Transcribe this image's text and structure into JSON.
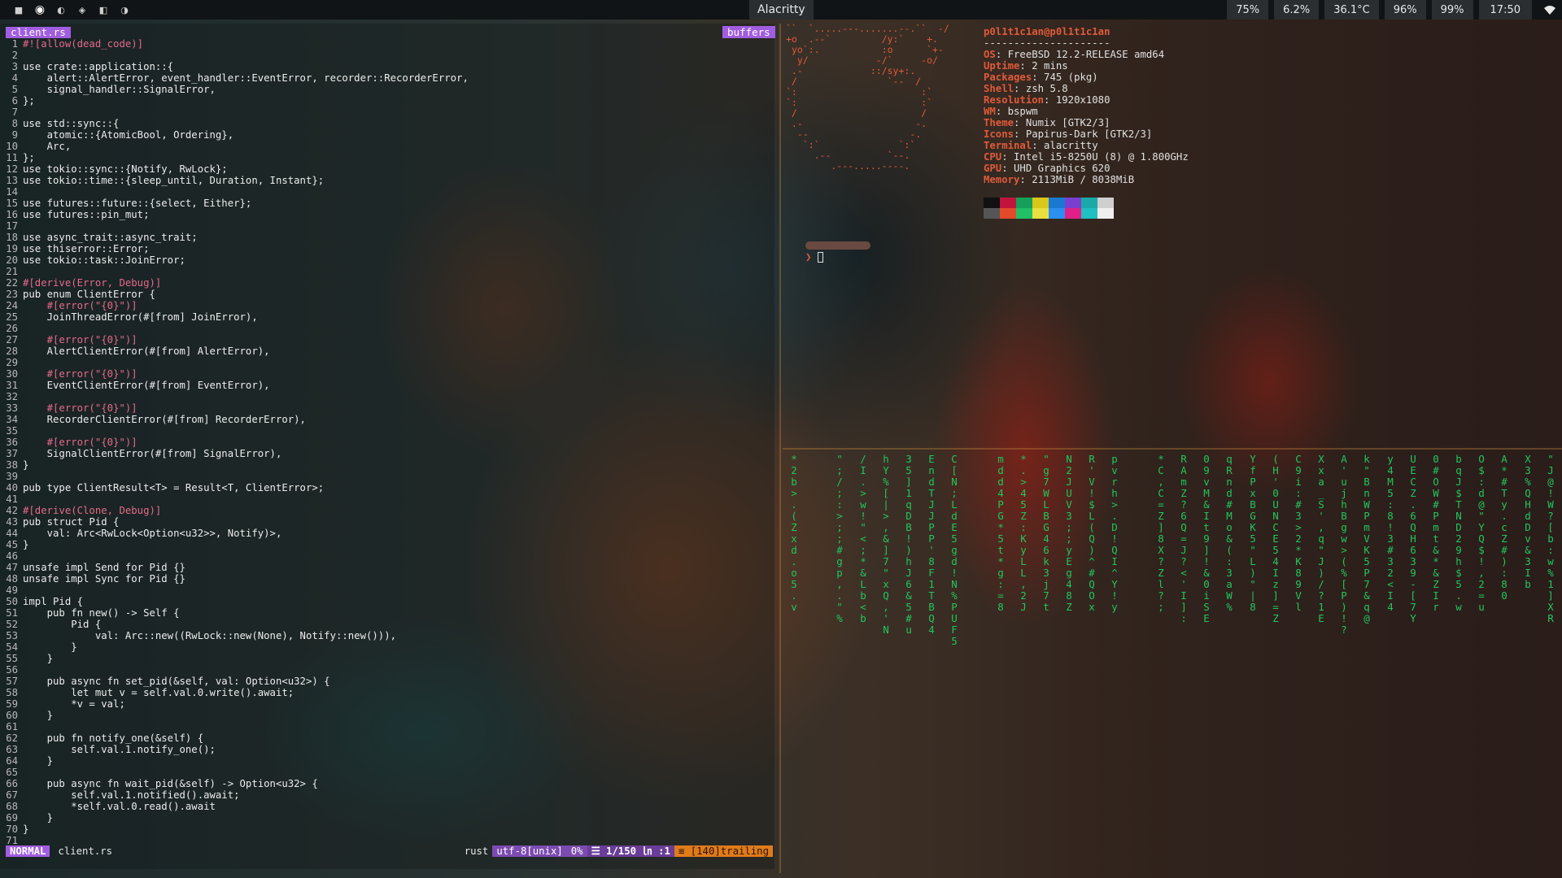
{
  "topbar": {
    "workspaces": [
      "■",
      "◉",
      "◐",
      "◈",
      "◧",
      "◑"
    ],
    "window_title": "Alacritty",
    "stats": [
      "75%",
      "6.2%",
      "36.1°C",
      "96%",
      "99%"
    ],
    "clock": "17:50",
    "wifi_icon": "wifi-icon"
  },
  "editor": {
    "file_tab": "client.rs",
    "buffers_tab": "buffers",
    "lines": [
      {
        "n": "1",
        "t": "#![allow(dead_code)]",
        "k": "cm"
      },
      {
        "n": "2",
        "t": "",
        "k": ""
      },
      {
        "n": "3",
        "t": "use crate::application::{",
        "k": ""
      },
      {
        "n": "4",
        "t": "    alert::AlertError, event_handler::EventError, recorder::RecorderError,",
        "k": ""
      },
      {
        "n": "5",
        "t": "    signal_handler::SignalError,",
        "k": ""
      },
      {
        "n": "6",
        "t": "};",
        "k": ""
      },
      {
        "n": "7",
        "t": "",
        "k": ""
      },
      {
        "n": "8",
        "t": "use std::sync::{",
        "k": ""
      },
      {
        "n": "9",
        "t": "    atomic::{AtomicBool, Ordering},",
        "k": ""
      },
      {
        "n": "10",
        "t": "    Arc,",
        "k": ""
      },
      {
        "n": "11",
        "t": "};",
        "k": ""
      },
      {
        "n": "12",
        "t": "use tokio::sync::{Notify, RwLock};",
        "k": ""
      },
      {
        "n": "13",
        "t": "use tokio::time::{sleep_until, Duration, Instant};",
        "k": ""
      },
      {
        "n": "14",
        "t": "",
        "k": ""
      },
      {
        "n": "15",
        "t": "use futures::future::{select, Either};",
        "k": ""
      },
      {
        "n": "16",
        "t": "use futures::pin_mut;",
        "k": ""
      },
      {
        "n": "17",
        "t": "",
        "k": ""
      },
      {
        "n": "18",
        "t": "use async_trait::async_trait;",
        "k": ""
      },
      {
        "n": "19",
        "t": "use thiserror::Error;",
        "k": ""
      },
      {
        "n": "20",
        "t": "use tokio::task::JoinError;",
        "k": ""
      },
      {
        "n": "21",
        "t": "",
        "k": ""
      },
      {
        "n": "22",
        "t": "#[derive(Error, Debug)]",
        "k": "cm"
      },
      {
        "n": "23",
        "t": "pub enum ClientError {",
        "k": ""
      },
      {
        "n": "24",
        "t": "    #[error(\"{0}\")]",
        "k": "cm"
      },
      {
        "n": "25",
        "t": "    JoinThreadError(#[from] JoinError),",
        "k": ""
      },
      {
        "n": "26",
        "t": "",
        "k": ""
      },
      {
        "n": "27",
        "t": "    #[error(\"{0}\")]",
        "k": "cm"
      },
      {
        "n": "28",
        "t": "    AlertClientError(#[from] AlertError),",
        "k": ""
      },
      {
        "n": "29",
        "t": "",
        "k": ""
      },
      {
        "n": "30",
        "t": "    #[error(\"{0}\")]",
        "k": "cm"
      },
      {
        "n": "31",
        "t": "    EventClientError(#[from] EventError),",
        "k": ""
      },
      {
        "n": "32",
        "t": "",
        "k": ""
      },
      {
        "n": "33",
        "t": "    #[error(\"{0}\")]",
        "k": "cm"
      },
      {
        "n": "34",
        "t": "    RecorderClientError(#[from] RecorderError),",
        "k": ""
      },
      {
        "n": "35",
        "t": "",
        "k": ""
      },
      {
        "n": "36",
        "t": "    #[error(\"{0}\")]",
        "k": "cm"
      },
      {
        "n": "37",
        "t": "    SignalClientError(#[from] SignalError),",
        "k": ""
      },
      {
        "n": "38",
        "t": "}",
        "k": ""
      },
      {
        "n": "39",
        "t": "",
        "k": ""
      },
      {
        "n": "40",
        "t": "pub type ClientResult<T> = Result<T, ClientError>;",
        "k": ""
      },
      {
        "n": "41",
        "t": "",
        "k": ""
      },
      {
        "n": "42",
        "t": "#[derive(Clone, Debug)]",
        "k": "cm"
      },
      {
        "n": "43",
        "t": "pub struct Pid {",
        "k": ""
      },
      {
        "n": "44",
        "t": "    val: Arc<RwLock<Option<u32>>, Notify)>,",
        "k": ""
      },
      {
        "n": "45",
        "t": "}",
        "k": ""
      },
      {
        "n": "46",
        "t": "",
        "k": ""
      },
      {
        "n": "47",
        "t": "unsafe impl Send for Pid {}",
        "k": ""
      },
      {
        "n": "48",
        "t": "unsafe impl Sync for Pid {}",
        "k": ""
      },
      {
        "n": "49",
        "t": "",
        "k": ""
      },
      {
        "n": "50",
        "t": "impl Pid {",
        "k": ""
      },
      {
        "n": "51",
        "t": "    pub fn new() -> Self {",
        "k": ""
      },
      {
        "n": "52",
        "t": "        Pid {",
        "k": ""
      },
      {
        "n": "53",
        "t": "            val: Arc::new((RwLock::new(None), Notify::new())),",
        "k": ""
      },
      {
        "n": "54",
        "t": "        }",
        "k": ""
      },
      {
        "n": "55",
        "t": "    }",
        "k": ""
      },
      {
        "n": "56",
        "t": "",
        "k": ""
      },
      {
        "n": "57",
        "t": "    pub async fn set_pid(&self, val: Option<u32>) {",
        "k": ""
      },
      {
        "n": "58",
        "t": "        let mut v = self.val.0.write().await;",
        "k": ""
      },
      {
        "n": "59",
        "t": "        *v = val;",
        "k": ""
      },
      {
        "n": "60",
        "t": "    }",
        "k": ""
      },
      {
        "n": "61",
        "t": "",
        "k": ""
      },
      {
        "n": "62",
        "t": "    pub fn notify_one(&self) {",
        "k": ""
      },
      {
        "n": "63",
        "t": "        self.val.1.notify_one();",
        "k": ""
      },
      {
        "n": "64",
        "t": "    }",
        "k": ""
      },
      {
        "n": "65",
        "t": "",
        "k": ""
      },
      {
        "n": "66",
        "t": "    pub async fn wait_pid(&self) -> Option<u32> {",
        "k": ""
      },
      {
        "n": "67",
        "t": "        self.val.1.notified().await;",
        "k": ""
      },
      {
        "n": "68",
        "t": "        *self.val.0.read().await",
        "k": ""
      },
      {
        "n": "69",
        "t": "    }",
        "k": ""
      },
      {
        "n": "70",
        "t": "}",
        "k": ""
      },
      {
        "n": "71",
        "t": "",
        "k": ""
      }
    ],
    "statusline": {
      "mode": "NORMAL",
      "file": "client.rs",
      "filetype": "rust",
      "encoding": "utf-8[unix]",
      "percent": "0%",
      "position": "☰ 1/150 ㏑ :1",
      "warning": "≡ [140]trailing"
    }
  },
  "neofetch": {
    "ascii": "``  `.....---.......--.``  -/\n+o  .--`         /y:`    +.\n yo`:.           :o      `+-\n  y/            -/`     -o/\n .-            ::/sy+:.\n /                `--  /\n`:                      :`\n`:                      :`\n /                      /\n .-                    -.\n  --                  -.\n   `:`              `:`\n     .--          `--.\n        .---.....----.",
    "userhost": "p0l1t1c1an@p0l1t1c1an",
    "separator": "---------------------",
    "info": [
      {
        "key": "OS",
        "value": "FreeBSD 12.2-RELEASE amd64"
      },
      {
        "key": "Uptime",
        "value": "2 mins"
      },
      {
        "key": "Packages",
        "value": "745 (pkg)"
      },
      {
        "key": "Shell",
        "value": "zsh 5.8"
      },
      {
        "key": "Resolution",
        "value": "1920x1080"
      },
      {
        "key": "WM",
        "value": "bspwm"
      },
      {
        "key": "Theme",
        "value": "Numix [GTK2/3]"
      },
      {
        "key": "Icons",
        "value": "Papirus-Dark [GTK2/3]"
      },
      {
        "key": "Terminal",
        "value": "alacritty"
      },
      {
        "key": "CPU",
        "value": "Intel i5-8250U (8) @ 1.800GHz"
      },
      {
        "key": "GPU",
        "value": "UHD Graphics 620"
      },
      {
        "key": "Memory",
        "value": "2113MiB / 8038MiB"
      }
    ],
    "colors_top": [
      "#111111",
      "#c0143c",
      "#14a05a",
      "#d9c71a",
      "#1a78d0",
      "#7a3fd0",
      "#1aa8a8",
      "#cfcfcf"
    ],
    "colors_bottom": [
      "#555555",
      "#e24a2a",
      "#22c066",
      "#e8e040",
      "#2a90f0",
      "#e0208a",
      "#20c0c0",
      "#f0f0f0"
    ],
    "prompt_symbol": "❯"
  },
  "matrix": {
    "columns": [
      "* 2 b > . ( Z x d . o 5 . v",
      "",
      "\" ; / ; : > ; ; # g p , . \" %",
      "/ I . > w ! \" < ; * & L b < b",
      "h Y % [ | > , & ] 7 \" x Q , ' N",
      "3 5 ] 1 q D B ! ) h J 6 & 5 # u",
      "E n d T J J P P ' 8 F 1 T B Q 4",
      "C [ N ; L d E 5 g d ! N % P U F 5",
      "",
      "m d d 4 P G * 5 t * g : = 8",
      "* . > 4 5 Z : K y L L , 2 J",
      "\" g 7 W L B G 4 6 k 3 j 7 t",
      "N 2 J U V 3 ; ; y E g 4 8 Z",
      "R ' V ! $ L ( Q ) ^ # Q O x",
      "p v r h > . D ! Q I ^ Y ! y",
      "",
      "* C , C = Z ] 8 X ? Z l ? ;",
      "R A m Z ? 6 Q = J ? < ' I ] :",
      "0 9 v M & I t 9 ] ! & 0 i S E",
      "q R n d # M o & ( : 3 a W %",
      "Y f P x B G K 5 \" L ) \" | 8",
      "( H ' 0 U N C E 5 4 I z ] = Z",
      "C 9 i : # 3 > 2 * K 8 9 V l",
      "X x a _ S ' , q \" J ) / ? 1 E",
      "A ' u j h B g w > ( % [ P ) ! ?",
      "k \" B n W P m V K 5 P 7 & q @",
      "y 4 M 5 : 8 ! 3 # 3 2 < I 4",
      "U E C Z . 6 Q H 6 3 9 - [ 7 Y",
      "0 # O W # P m t & * & Z I r",
      "b q J $ T N D 2 9 h $ 5 . w",
      "O $ : d @ \" Y Q $ ! , 2 = u",
      "A * # T y . c Z # ) : 8 0",
      "X 3 % Q H d D v & 3 I b",
      "\" J @ ! W ? [ b : w % 1 ] X R"
    ]
  }
}
